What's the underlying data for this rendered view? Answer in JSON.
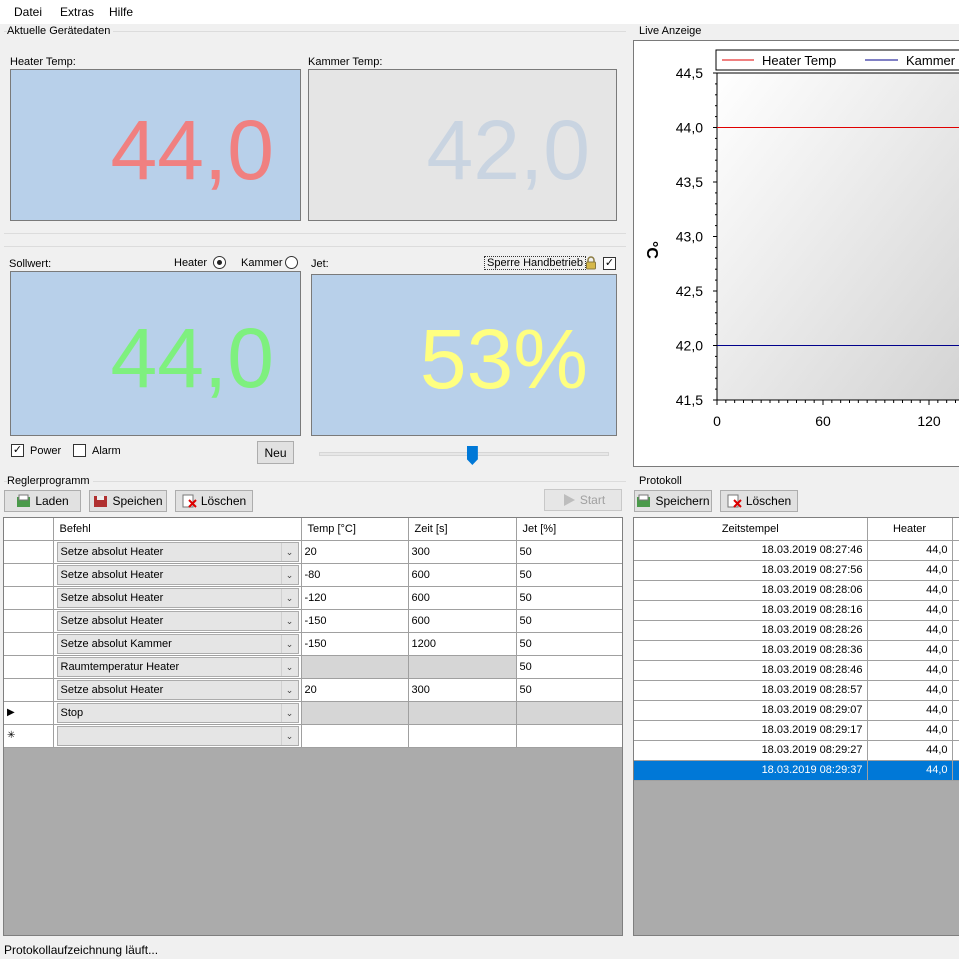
{
  "menu": {
    "items": [
      "Datei",
      "Extras",
      "Hilfe"
    ]
  },
  "current_data": {
    "title": "Aktuelle Gerätedaten",
    "heater_label": "Heater Temp:",
    "heater_value": "44,0",
    "chamber_label": "Kammer Temp:",
    "chamber_value": "42,0"
  },
  "setpoint": {
    "label": "Sollwert:",
    "radio_heater": "Heater",
    "radio_chamber": "Kammer",
    "value": "44,0",
    "jet_label": "Jet:",
    "lock_label": "Sperre Handbetrieb",
    "jet_value": "53%",
    "jet_slider_percent": 53,
    "power_label": "Power",
    "alarm_label": "Alarm",
    "new_button": "Neu"
  },
  "program": {
    "title": "Reglerprogramm",
    "load_button": "Laden",
    "save_button": "Speichen",
    "delete_button": "Löschen",
    "start_button": "Start",
    "columns": [
      "Befehl",
      "Temp [°C]",
      "Zeit [s]",
      "Jet [%]"
    ],
    "rows": [
      {
        "marker": "",
        "command": "Setze absolut Heater",
        "temp": "20",
        "time": "300",
        "jet": "50"
      },
      {
        "marker": "",
        "command": "Setze absolut Heater",
        "temp": "-80",
        "time": "600",
        "jet": "50"
      },
      {
        "marker": "",
        "command": "Setze absolut Heater",
        "temp": "-120",
        "time": "600",
        "jet": "50"
      },
      {
        "marker": "",
        "command": "Setze absolut Heater",
        "temp": "-150",
        "time": "600",
        "jet": "50"
      },
      {
        "marker": "",
        "command": "Setze absolut Kammer",
        "temp": "-150",
        "time": "1200",
        "jet": "50"
      },
      {
        "marker": "",
        "command": "Raumtemperatur Heater",
        "temp": "",
        "time": "",
        "jet": "50"
      },
      {
        "marker": "",
        "command": "Setze absolut Heater",
        "temp": "20",
        "time": "300",
        "jet": "50"
      },
      {
        "marker": "▶",
        "command": "Stop",
        "temp": "",
        "time": "",
        "jet": ""
      },
      {
        "marker": "✳",
        "command": "",
        "temp": "",
        "time": "",
        "jet": ""
      }
    ]
  },
  "live": {
    "title": "Live Anzeige",
    "chart_data": {
      "type": "line",
      "legend": [
        "Heater Temp",
        "Kammer"
      ],
      "ylabel": "°C",
      "ylim": [
        41.5,
        44.5
      ],
      "yticks": [
        "44,5",
        "44,0",
        "43,5",
        "43,0",
        "42,5",
        "42,0",
        "41,5"
      ],
      "xticks": [
        "0",
        "60",
        "120"
      ],
      "series": [
        {
          "name": "Heater Temp",
          "color": "#e00000",
          "y_constant": 44.0
        },
        {
          "name": "Kammer",
          "color": "#00008b",
          "y_constant": 42.0
        }
      ]
    }
  },
  "protocol": {
    "title": "Protokoll",
    "save_button": "Speichern",
    "delete_button": "Löschen",
    "columns": [
      "Zeitstempel",
      "Heater"
    ],
    "rows": [
      {
        "timestamp": "18.03.2019 08:27:46",
        "heater": "44,0"
      },
      {
        "timestamp": "18.03.2019 08:27:56",
        "heater": "44,0"
      },
      {
        "timestamp": "18.03.2019 08:28:06",
        "heater": "44,0"
      },
      {
        "timestamp": "18.03.2019 08:28:16",
        "heater": "44,0"
      },
      {
        "timestamp": "18.03.2019 08:28:26",
        "heater": "44,0"
      },
      {
        "timestamp": "18.03.2019 08:28:36",
        "heater": "44,0"
      },
      {
        "timestamp": "18.03.2019 08:28:46",
        "heater": "44,0"
      },
      {
        "timestamp": "18.03.2019 08:28:57",
        "heater": "44,0"
      },
      {
        "timestamp": "18.03.2019 08:29:07",
        "heater": "44,0"
      },
      {
        "timestamp": "18.03.2019 08:29:17",
        "heater": "44,0"
      },
      {
        "timestamp": "18.03.2019 08:29:27",
        "heater": "44,0"
      },
      {
        "timestamp": "18.03.2019 08:29:37",
        "heater": "44,0"
      }
    ],
    "selected_index": 11
  },
  "status": {
    "text": "Protokollaufzeichnung läuft..."
  },
  "colors": {
    "display_blue": "#b8d0ea",
    "display_grey": "#e5e5e5",
    "heater_text": "#f08080",
    "chamber_text": "#c9d4e1",
    "setpoint_text": "#7ef07e",
    "jet_text": "#ffff80",
    "selection": "#0078d7"
  }
}
